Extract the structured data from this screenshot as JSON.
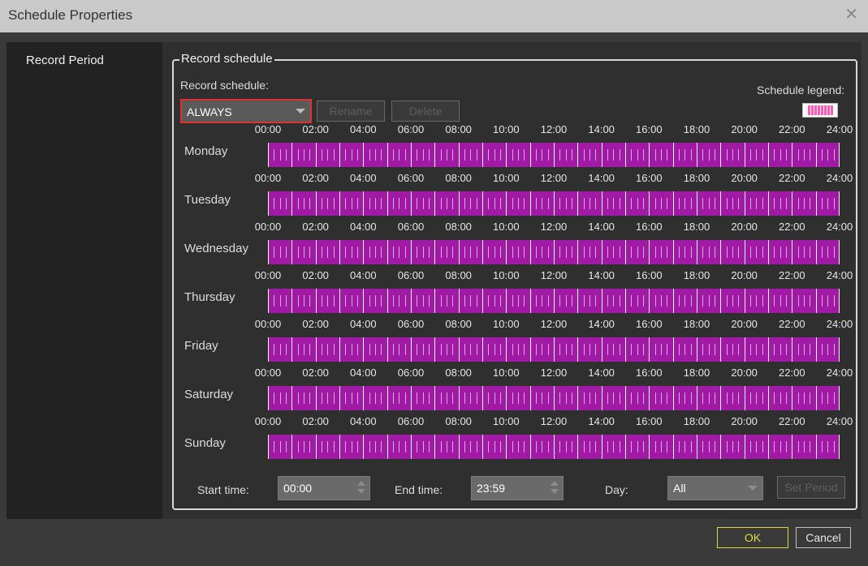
{
  "window": {
    "title": "Schedule Properties",
    "close_glyph": "✕"
  },
  "sidebar": {
    "items": [
      {
        "label": "Record Period"
      }
    ]
  },
  "group": {
    "title": "Record schedule"
  },
  "schedule_select": {
    "label": "Record schedule:",
    "value": "ALWAYS"
  },
  "buttons": {
    "rename": "Rename",
    "delete": "Delete",
    "set_period": "Set Period",
    "ok": "OK",
    "cancel": "Cancel"
  },
  "legend": {
    "label": "Schedule legend:"
  },
  "hours": [
    "00:00",
    "02:00",
    "04:00",
    "06:00",
    "08:00",
    "10:00",
    "12:00",
    "14:00",
    "16:00",
    "18:00",
    "20:00",
    "22:00",
    "24:00"
  ],
  "days": [
    {
      "name": "Monday"
    },
    {
      "name": "Tuesday"
    },
    {
      "name": "Wednesday"
    },
    {
      "name": "Thursday"
    },
    {
      "name": "Friday"
    },
    {
      "name": "Saturday"
    },
    {
      "name": "Sunday"
    }
  ],
  "period": {
    "start_label": "Start time:",
    "start_value": "00:00",
    "end_label": "End time:",
    "end_value": "23:59",
    "day_label": "Day:",
    "day_value": "All"
  },
  "colors": {
    "schedule_fill": "#a01aa6",
    "legend_fill": "#ff5ab8",
    "highlight_border": "#e03030"
  }
}
